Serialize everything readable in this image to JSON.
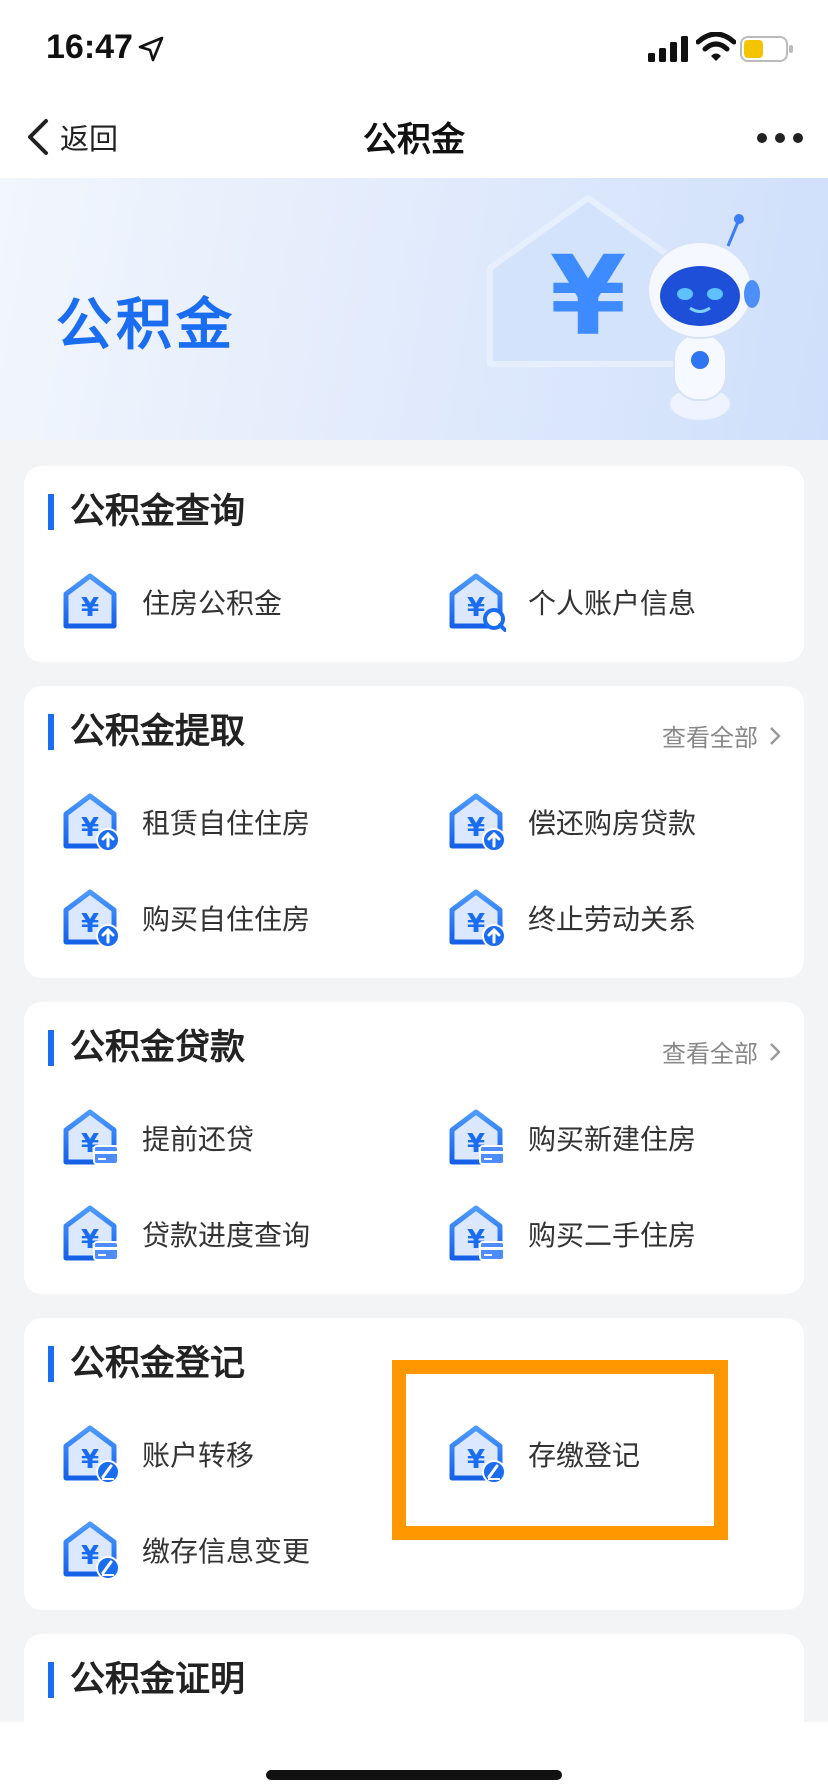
{
  "status_bar": {
    "time": "16:47"
  },
  "nav": {
    "back_label": "返回",
    "title": "公积金"
  },
  "banner": {
    "title": "公积金",
    "symbol": "¥"
  },
  "view_all_label": "查看全部",
  "colors": {
    "accent": "#1a6cf0",
    "highlight": "#ff9800",
    "battery": "#f5c400"
  },
  "sections": {
    "query": {
      "title": "公积金查询",
      "items": [
        "住房公积金",
        "个人账户信息"
      ]
    },
    "withdraw": {
      "title": "公积金提取",
      "items": [
        "租赁自住住房",
        "偿还购房贷款",
        "购买自住住房",
        "终止劳动关系"
      ]
    },
    "loan": {
      "title": "公积金贷款",
      "items": [
        "提前还贷",
        "购买新建住房",
        "贷款进度查询",
        "购买二手住房"
      ]
    },
    "register": {
      "title": "公积金登记",
      "items": [
        "账户转移",
        "存缴登记",
        "缴存信息变更"
      ]
    },
    "certificate": {
      "title": "公积金证明"
    }
  }
}
